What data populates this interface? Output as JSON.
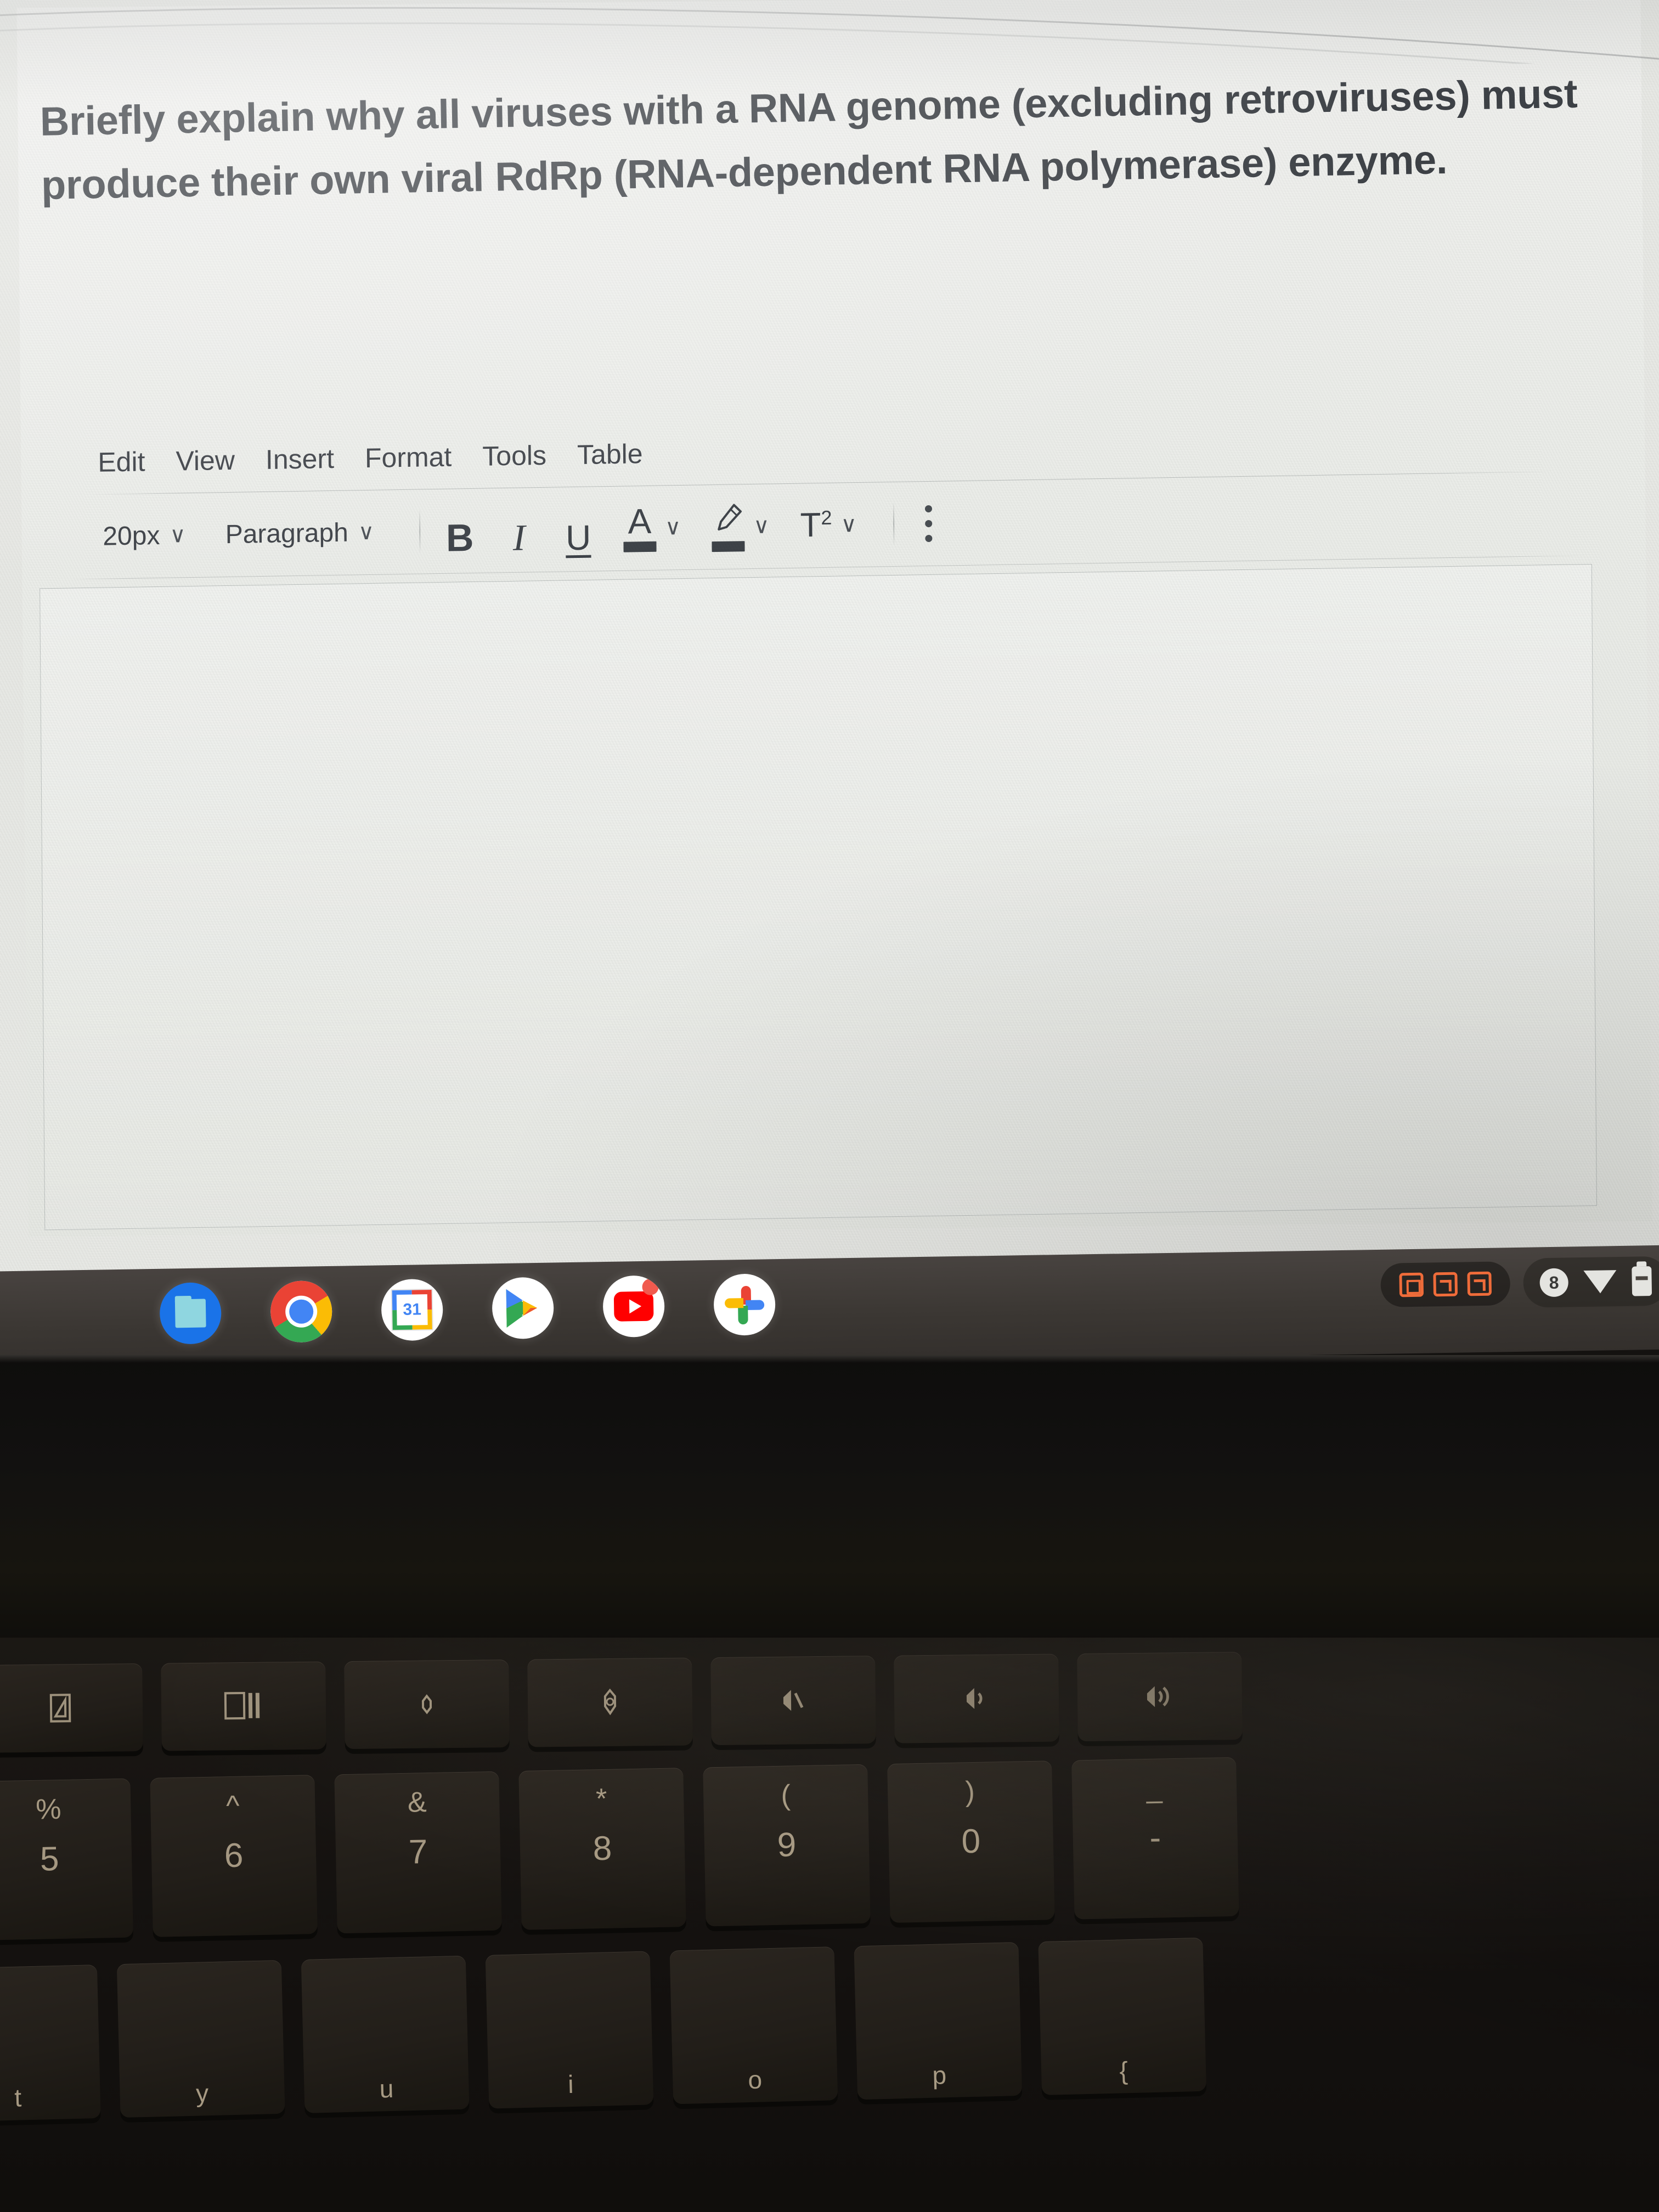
{
  "prompt": {
    "text": "Briefly explain why all viruses with a RNA genome (excluding retroviruses) must produce their own viral RdRp (RNA-dependent RNA polymerase) enzyme."
  },
  "editor": {
    "menu": [
      {
        "label": "Edit"
      },
      {
        "label": "View"
      },
      {
        "label": "Insert"
      },
      {
        "label": "Format"
      },
      {
        "label": "Tools"
      },
      {
        "label": "Table"
      }
    ],
    "toolbar": {
      "font_size": {
        "value": "20px",
        "chevron": "∨"
      },
      "block_format": {
        "value": "Paragraph",
        "chevron": "∨"
      },
      "bold": "B",
      "italic": "I",
      "underline": "U",
      "text_color": {
        "glyph": "A",
        "chevron": "∨",
        "swatch_color": "#3d4247"
      },
      "highlight_color": {
        "chevron": "∨",
        "swatch_color": "#3d4247"
      },
      "superscript": {
        "glyph": "T",
        "exponent": "2",
        "chevron": "∨"
      },
      "more_options": "⋮"
    },
    "body_text": ""
  },
  "shelf": {
    "apps": [
      {
        "name": "Files",
        "running": true
      },
      {
        "name": "Chrome",
        "running": true
      },
      {
        "name": "Calendar",
        "day": "31",
        "running": false
      },
      {
        "name": "Play Store",
        "running": false
      },
      {
        "name": "YouTube",
        "running": false
      },
      {
        "name": "Photos",
        "running": false
      }
    ],
    "tray": {
      "capture_icons": [
        "screen-capture",
        "screen-record",
        "screen-cast"
      ],
      "capture_color": "#ef6c3a",
      "notification_count": "8",
      "wifi": "connected",
      "battery": "charged"
    }
  },
  "keyboard": {
    "function_row": [
      {
        "icon": "screen-mirror-key"
      },
      {
        "icon": "overview-windows-key"
      },
      {
        "icon": "brightness-down-key"
      },
      {
        "icon": "brightness-up-key"
      },
      {
        "icon": "mute-key"
      },
      {
        "icon": "volume-down-key"
      },
      {
        "icon": "volume-up-key"
      }
    ],
    "number_row": [
      {
        "upper": "%",
        "lower": "5"
      },
      {
        "upper": "^",
        "lower": "6"
      },
      {
        "upper": "&",
        "lower": "7"
      },
      {
        "upper": "*",
        "lower": "8"
      },
      {
        "upper": "(",
        "lower": "9"
      },
      {
        "upper": ")",
        "lower": "0"
      },
      {
        "upper": "_",
        "lower": "-"
      }
    ],
    "letter_row": [
      {
        "lower": "t"
      },
      {
        "lower": "y"
      },
      {
        "lower": "u"
      },
      {
        "lower": "i"
      },
      {
        "lower": "o"
      },
      {
        "lower": "p"
      },
      {
        "lower": "{"
      }
    ]
  }
}
